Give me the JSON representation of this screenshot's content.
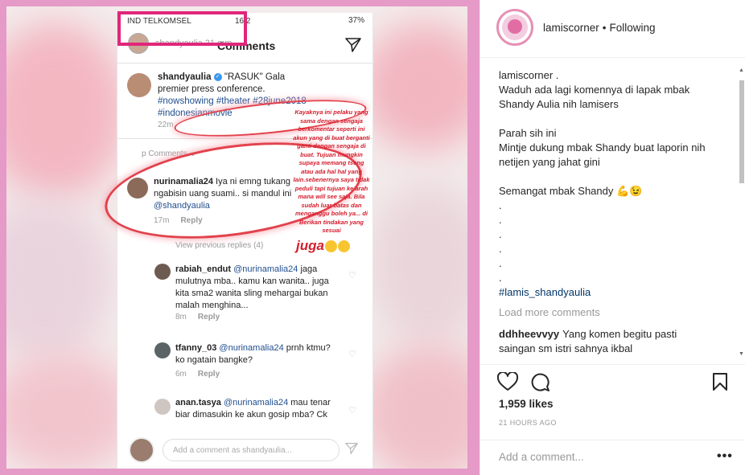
{
  "post_image": {
    "status": {
      "carrier": "IND TELKOMSEL",
      "time": "16:2",
      "battery": "37%"
    },
    "story_header": {
      "user": "shandyaulia",
      "ago": "21 mm",
      "title": "Comments"
    },
    "caption": {
      "user": "shandyaulia",
      "text": "\"RASUK\" Gala premier press conference.",
      "tags": "#nowshowing #theater #28june2018 #indonesianmovie",
      "time": "22m"
    },
    "toggle_label": "p Comments",
    "comments": [
      {
        "user": "nurinamalia24",
        "text": "Iya ni emng tukang ngabisin uang suami.. si mandul ini",
        "mention": "@shandyaulia",
        "time": "17m",
        "reply": "Reply"
      },
      {
        "user": "rabiah_endut",
        "mention": "@nurinamalia24",
        "text": "jaga mulutnya mba.. kamu kan wanita.. juga kita sma2 wanita sling mehargai bukan malah menghina...",
        "time": "8m",
        "reply": "Reply"
      },
      {
        "user": "tfanny_03",
        "mention": "@nurinamalia24",
        "text": "prnh ktmu? ko ngatain bangke?",
        "time": "6m",
        "reply": "Reply"
      },
      {
        "user": "anan.tasya",
        "mention": "@nurinamalia24",
        "text": "mau tenar biar dimasukin ke akun gosip mba? Ck",
        "time": "",
        "reply": ""
      }
    ],
    "view_replies": "View previous replies (4)",
    "add_comment_placeholder": "Add a comment as shandyaulia...",
    "annotation": "Kayaknya ini pelaku yang sama dengan sengaja berkomentar seperti ini akun yang di buat berganti ganti dengan sengaja di buat. Tujuan mungkin supaya memang tseng atau ada hal hal yang lain.sebenernya saya tidak peduli tapi tujuan ke arah mana will see saja. Bila sudah luar batas dan menganggu boleh ya... di Berikan tindakan yang sesuai",
    "annotation_big": "juga"
  },
  "sidebar": {
    "header": {
      "username": "lamiscorner",
      "separator": "•",
      "follow_status": "Following"
    },
    "caption_lines": [
      "lamiscorner .",
      "Waduh ada lagi komennya di lapak mbak Shandy Aulia nih lamisers",
      "",
      "Parah sih ini",
      "Mintje dukung mbak Shandy buat laporin nih netijen yang jahat gini",
      "",
      "Semangat mbak Shandy 💪😉",
      ".",
      ".",
      ".",
      ".",
      ".",
      "."
    ],
    "hashtag": "#lamis_shandyaulia",
    "load_more": "Load more comments",
    "comment": {
      "user": "ddhheevvyy",
      "text": "Yang komen begitu pasti saingan sm istri sahnya ikbal"
    },
    "likes": "1,959 likes",
    "time_ago": "21 HOURS AGO",
    "add_comment_placeholder": "Add a comment...",
    "more_label": "•••"
  },
  "colors": {
    "frame_pink": "#e59ac7",
    "highlight_magenta": "#e0277a",
    "annotation_red": "#d41d2c",
    "link_blue": "#003569"
  },
  "icons": [
    "heart-icon",
    "comment-icon",
    "bookmark-icon",
    "send-icon",
    "verified-badge-icon"
  ]
}
